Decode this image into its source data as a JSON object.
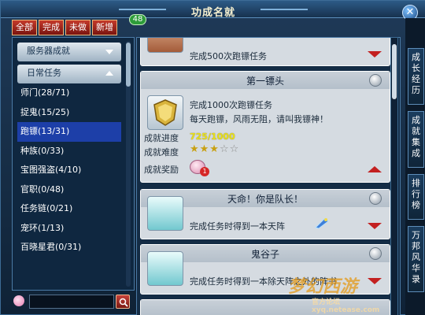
{
  "window": {
    "title": "功成名就",
    "close_label": "✕"
  },
  "tabs": [
    {
      "label": "全部"
    },
    {
      "label": "完成"
    },
    {
      "label": "未做"
    },
    {
      "label": "新增"
    }
  ],
  "new_count": "48",
  "left": {
    "category_1": "服务器成就",
    "category_2": "日常任务",
    "items": [
      {
        "label": "师门(28/71)"
      },
      {
        "label": "捉鬼(15/25)"
      },
      {
        "label": "跑镖(13/31)",
        "selected": true
      },
      {
        "label": "种族(0/33)"
      },
      {
        "label": "宝图强盗(4/10)"
      },
      {
        "label": "官职(0/48)"
      },
      {
        "label": "任务链(0/21)"
      },
      {
        "label": "宠环(1/13)"
      },
      {
        "label": "百晓星君(0/31)"
      }
    ],
    "search_placeholder": ""
  },
  "cards": [
    {
      "title": "",
      "desc": "完成500次跑镖任务"
    },
    {
      "title": "第一镖头",
      "desc": "完成1000次跑镖任务",
      "desc2": "每天跑镖，风雨无阻，请叫我镖神！",
      "progress_label": "成就进度",
      "progress_value": "725/1000",
      "difficulty_label": "成就难度",
      "difficulty_stars": "★★★",
      "difficulty_empty": "☆☆",
      "reward_label": "成就奖励",
      "reward_count": "1"
    },
    {
      "title": "天命！你是队长！",
      "desc": "完成任务时得到一本天阵"
    },
    {
      "title": "鬼谷子",
      "desc": "完成任务时得到一本除天阵之外的阵书"
    }
  ],
  "side": [
    {
      "label": "成长经历"
    },
    {
      "label": "成就集成"
    },
    {
      "label": "排行榜"
    },
    {
      "label": "万邦风华录"
    }
  ],
  "watermark": {
    "text": "梦幻西游",
    "sub": "官方论坛 xyq.netease.com"
  },
  "colors": {
    "accent_red": "#c32020",
    "selected_blue": "#1d3fa8",
    "progress_yellow": "#e8e01a"
  }
}
